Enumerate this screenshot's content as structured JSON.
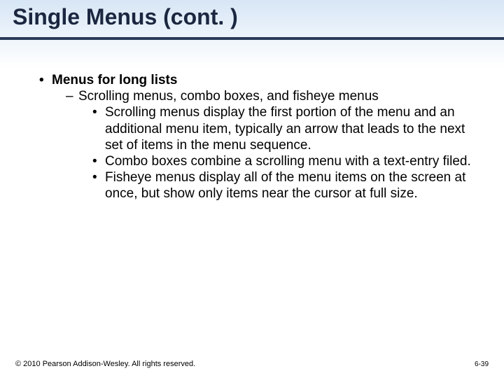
{
  "title": "Single Menus (cont. )",
  "bullets": {
    "topic": "Menus for long lists",
    "subtopic": "Scrolling menus, combo boxes, and fisheye menus",
    "items": [
      "Scrolling menus display the first portion of the menu and an additional menu item, typically an arrow that leads to the next set of items in the menu sequence.",
      "Combo boxes combine a scrolling menu with a text-entry filed.",
      "Fisheye menus display all of the menu items on the screen at once, but show only items near the cursor at full size."
    ]
  },
  "footer": {
    "copyright": "© 2010 Pearson Addison-Wesley. All rights reserved.",
    "pagenum": "6-39"
  }
}
